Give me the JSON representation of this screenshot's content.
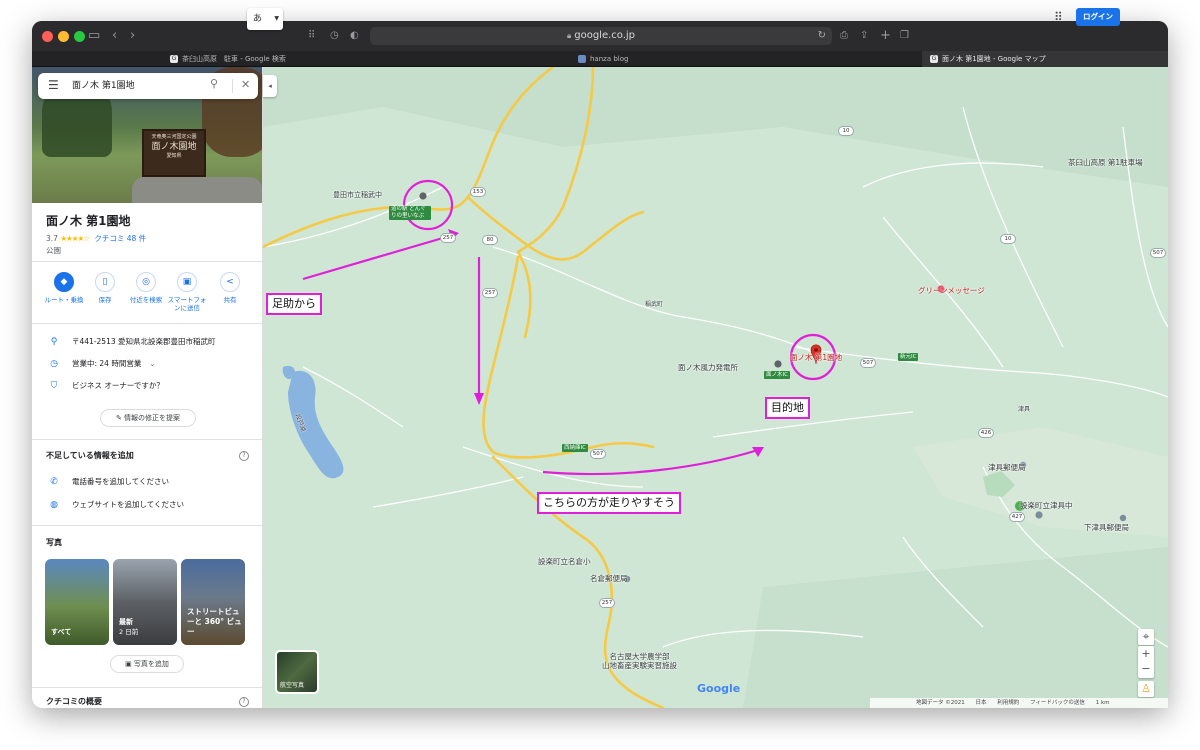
{
  "browser": {
    "url": "google.co.jp",
    "tabs": [
      {
        "favicon": "G",
        "label": "茶臼山高原　駐車 - Google 検索",
        "active": false
      },
      {
        "favicon": "",
        "label": "hanza blog",
        "active": false
      },
      {
        "favicon": "G",
        "label": "面ノ木 第1園地 - Google マップ",
        "active": true
      }
    ]
  },
  "search": {
    "query": "面ノ木 第1園地"
  },
  "photo_sign": {
    "line1": "天竜奥三河国定公園",
    "line2": "面ノ木園地",
    "line3": "愛知県"
  },
  "place": {
    "title": "面ノ木 第1園地",
    "rating": "3.7",
    "stars": "★★★★☆",
    "reviews": "クチコミ 48 件",
    "category": "公園"
  },
  "actions": [
    {
      "label": "ルート・乗換",
      "icon": "◆"
    },
    {
      "label": "保存",
      "icon": "▯"
    },
    {
      "label": "付近を検索",
      "icon": "◎"
    },
    {
      "label": "スマートフォンに送信",
      "icon": "▣"
    },
    {
      "label": "共有",
      "icon": "<"
    }
  ],
  "info": {
    "address": "〒441-2513 愛知県北設楽郡豊田市稲武町",
    "hours": "営業中:  24 時間営業",
    "owner": "ビジネス オーナーですか？",
    "suggest_edit": "情報の修正を提案"
  },
  "missing": {
    "title": "不足している情報を追加",
    "phone": "電話番号を追加してください",
    "website": "ウェブサイトを追加してください"
  },
  "photos": {
    "title": "写真",
    "thumbs": [
      {
        "label": "すべて",
        "sub": ""
      },
      {
        "label": "最新",
        "sub": "2 日前"
      },
      {
        "label": "ストリートビューと 360° ビュー",
        "sub": ""
      }
    ],
    "add_label": "写真を追加"
  },
  "reviews_section": {
    "title": "クチコミの概要"
  },
  "map_controls": {
    "ime": "あ",
    "login": "ログイン",
    "aerial": "航空写真",
    "google": "Google"
  },
  "map_labels": {
    "school": "豊田市立稲武中",
    "michi_no_eki": "道の駅 どんぐりの里いなぶ",
    "inabu": "稲武町",
    "wind_farm": "面ノ木風力発電所",
    "destination_pin": "面ノ木 第1園地",
    "menoki_ic": "面ノ木IC",
    "nishinatesawa_ic": "西納庫IC",
    "shinkan_ic": "新元IC",
    "chausu_parking": "茶臼山高原 第1駐車場",
    "green_message": "グリーンメッセージ",
    "tsugu": "津具",
    "tsugu_post": "津具郵便局",
    "shitara_tsugu": "設楽町立津具中",
    "shimotsugu_post": "下津具郵便局",
    "shitara_nakura": "設楽町立名倉小",
    "nakura_post": "名倉郵便局",
    "nagoya_univ": "名古屋大学農学部\n山地畜産実験実習施設",
    "lake": "段戸湖"
  },
  "road_shields": [
    "153",
    "257",
    "80",
    "257",
    "10",
    "507",
    "426",
    "507",
    "427",
    "257",
    "10",
    "507"
  ],
  "annotations": {
    "start": "足助から",
    "destination": "目的地",
    "easier": "こちらの方が走りやすそう"
  },
  "footer": {
    "data": "地図データ ©2021",
    "country": "日本",
    "terms": "利用規約",
    "feedback": "フィードバックの送信",
    "scale": "1 km"
  },
  "colors": {
    "annotation": "#e020d8",
    "road_major": "#f6c945",
    "road_minor": "#ffffff",
    "water": "#8ab4e0",
    "link": "#1a73e8"
  }
}
